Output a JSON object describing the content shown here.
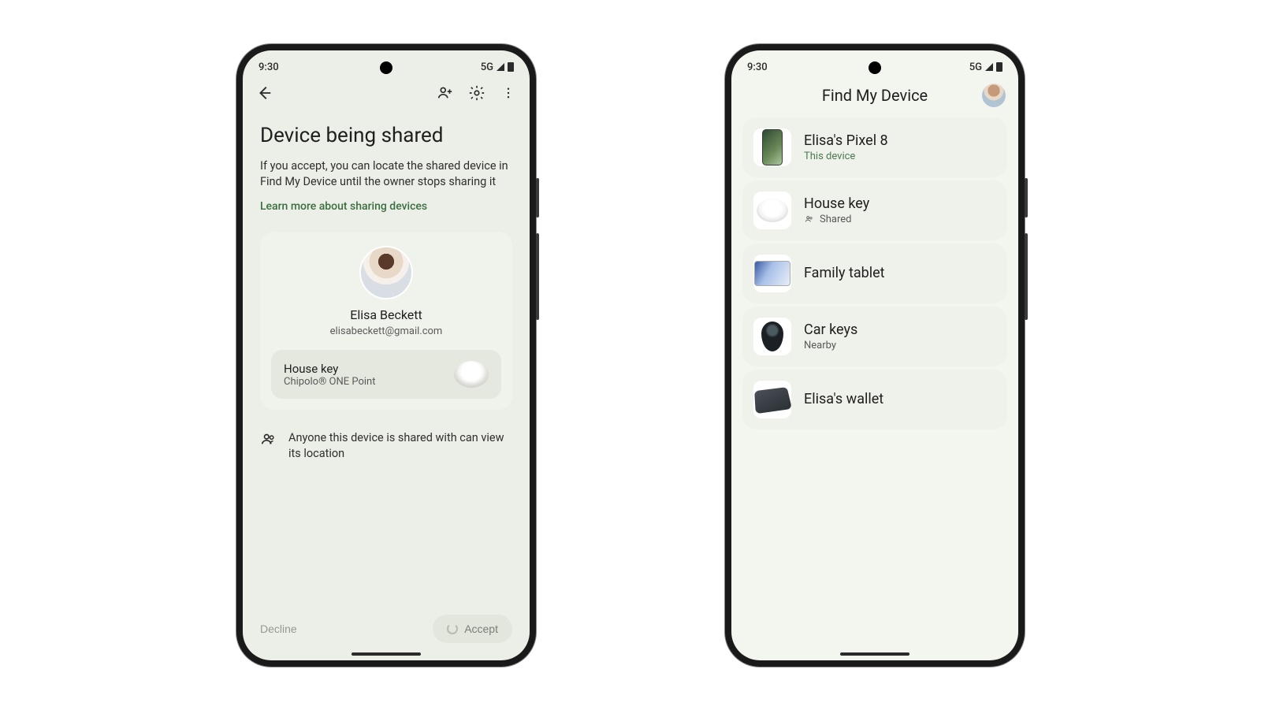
{
  "status": {
    "time": "9:30",
    "network": "5G"
  },
  "left": {
    "title": "Device being shared",
    "body": "If you accept, you can locate the shared device in Find My Device until the owner stops sharing it",
    "learn_more": "Learn more about sharing devices",
    "profile_name": "Elisa Beckett",
    "profile_email": "elisabeckett@gmail.com",
    "device_name": "House key",
    "device_model": "Chipolo® ONE Point",
    "share_note": "Anyone this device is shared with can view its location",
    "decline": "Decline",
    "accept": "Accept"
  },
  "right": {
    "title": "Find My Device",
    "items": [
      {
        "name": "Elisa's Pixel 8",
        "sub": "This device",
        "sub_style": "green"
      },
      {
        "name": "House key",
        "sub": "Shared",
        "sub_style": "gray_icon"
      },
      {
        "name": "Family tablet",
        "sub": "",
        "sub_style": ""
      },
      {
        "name": "Car keys",
        "sub": "Nearby",
        "sub_style": "gray"
      },
      {
        "name": "Elisa's wallet",
        "sub": "",
        "sub_style": ""
      }
    ]
  }
}
